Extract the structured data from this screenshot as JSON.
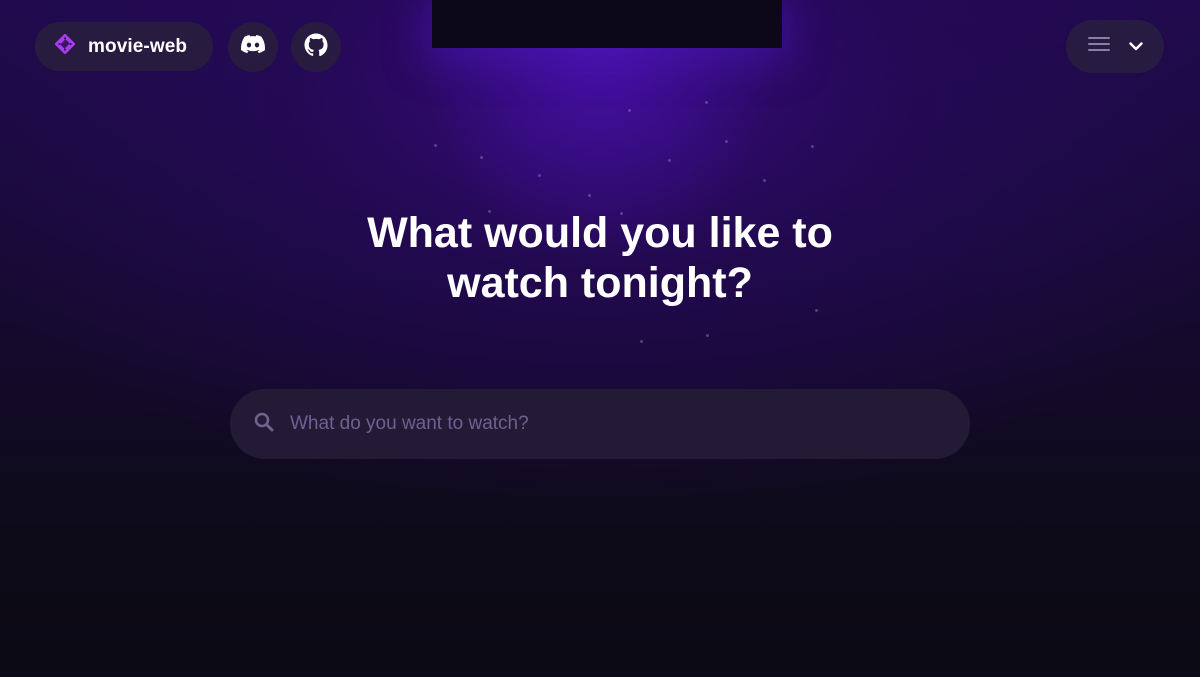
{
  "header": {
    "brand_label": "movie-web",
    "brand_icon": "film-icon",
    "discord_icon": "discord-icon",
    "github_icon": "github-icon",
    "menu_icon": "hamburger-icon",
    "dropdown_icon": "chevron-down-icon"
  },
  "hero": {
    "title_line1": "What would you like to",
    "title_line2": "watch tonight?"
  },
  "search": {
    "placeholder": "What do you want to watch?",
    "value": "",
    "icon": "search-icon"
  },
  "colors": {
    "accent": "#a93bf0",
    "background_top": "#1f0a4a",
    "background_bottom": "#0c0a14",
    "pill_bg": "#281e3e",
    "search_bg": "#231a36",
    "placeholder": "#6f6190"
  }
}
